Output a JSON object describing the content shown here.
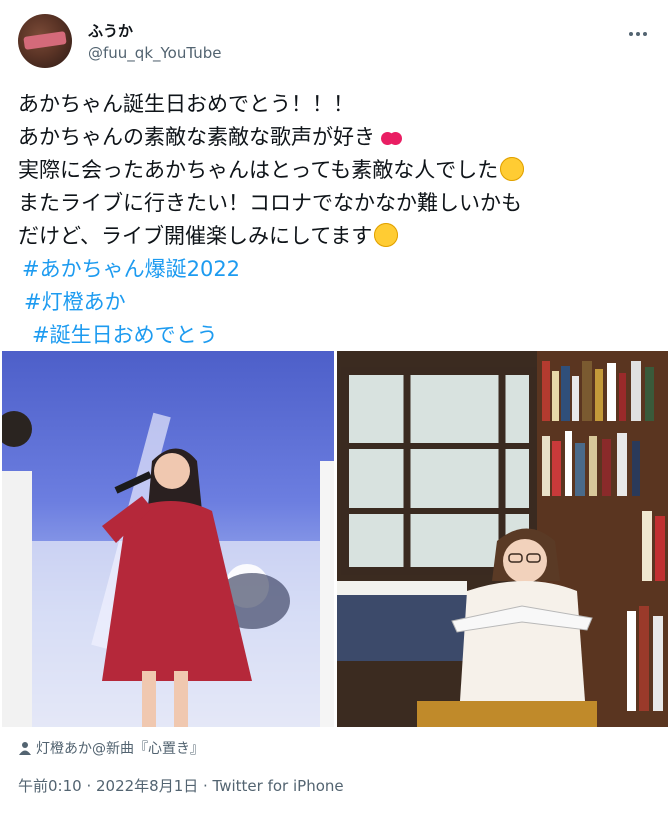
{
  "author": {
    "name": "ふうか",
    "handle": "@fuu_qk_YouTube"
  },
  "more_icon": "more-horizontal-icon",
  "tweet": {
    "lines": [
      "あかちゃん誕生日おめでとう！！！",
      "あかちゃんの素敵な素敵な歌声が好き",
      "実際に会ったあかちゃんはとっても素敵な人でした",
      "またライブに行きたい！コロナでなかなか難しいかも",
      "だけど、ライブ開催楽しみにしてます"
    ],
    "hashtags": [
      "#あかちゃん爆誕2022",
      "#灯橙あか",
      "#誕生日おめでとう"
    ]
  },
  "media_tag": "灯橙あか@新曲『心置き』",
  "footer": {
    "timestamp": "午前0:10 · 2022年8月1日 · Twitter for iPhone"
  },
  "colors": {
    "link": "#1d9bf0",
    "muted": "#536471",
    "text": "#0f1419"
  }
}
